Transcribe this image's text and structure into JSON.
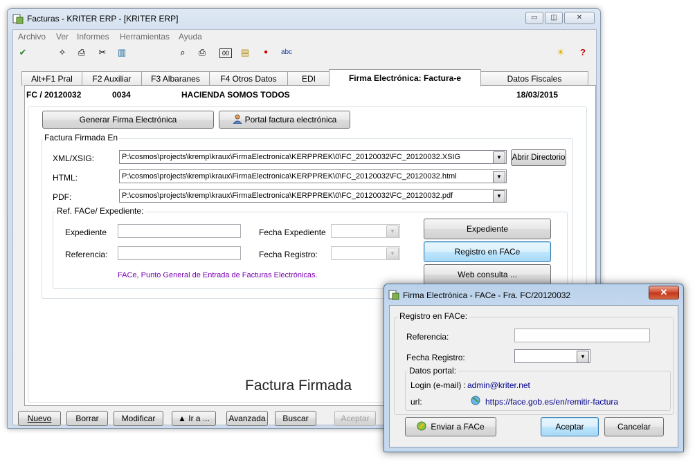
{
  "main": {
    "title": "Facturas - KRITER ERP - [KRITER ERP]",
    "caption_buttons": {
      "minimize": "▭",
      "restore": "◫",
      "close": "✕"
    },
    "menu": [
      "Archivo",
      "Ver",
      "Informes",
      "Herramientas",
      "Ayuda"
    ],
    "toolbar_icons": {
      "check": "✔",
      "run": "✧",
      "print": "⎙",
      "cut": "✂",
      "chart": "▥",
      "preview": "⌕",
      "printer": "⎙",
      "counter": "00",
      "folder": "▤",
      "bell": "●",
      "abc": "abc",
      "bulb": "☀",
      "help": "?"
    },
    "tabs": [
      "Alt+F1 Pral",
      "F2 Auxiliar",
      "F3 Albaranes",
      "F4 Otros Datos",
      "EDI",
      "Firma Electrónica: Factura-e",
      "Datos Fiscales"
    ],
    "header": {
      "code": "FC / 20120032",
      "num": "0034",
      "client": "HACIENDA SOMOS TODOS",
      "date": "18/03/2015"
    },
    "buttons": {
      "generar": "Generar Firma Electrónica",
      "portal": "Portal factura electrónica"
    },
    "factura_firmada": {
      "group_label": "Factura Firmada En",
      "xml_label": "XML/XSIG:",
      "xml_value": "P:\\cosmos\\projects\\kremp\\kraux\\FirmaElectronica\\KERPPREK\\0\\FC_20120032\\FC_20120032.XSIG",
      "html_label": "HTML:",
      "html_value": "P:\\cosmos\\projects\\kremp\\kraux\\FirmaElectronica\\KERPPREK\\0\\FC_20120032\\FC_20120032.html",
      "pdf_label": "PDF:",
      "pdf_value": "P:\\cosmos\\projects\\kremp\\kraux\\FirmaElectronica\\KERPPREK\\0\\FC_20120032\\FC_20120032.pdf",
      "abrir": "Abrir Directorio"
    },
    "ref_face": {
      "group_label": "Ref. FACe/ Expediente:",
      "expediente_label": "Expediente",
      "referencia_label": "Referencia:",
      "fecha_exp_label": "Fecha Expediente",
      "fecha_reg_label": "Fecha Registro:",
      "link_text": "FACe, Punto General de Entrada de Facturas Electrónicas.",
      "btn_expediente": "Expediente",
      "btn_registro": "Registro en FACe",
      "btn_web": "Web consulta ..."
    },
    "status_big": "Factura Firmada",
    "bottom_buttons": [
      "Nuevo",
      "Borrar",
      "Modificar",
      "▲ Ir a ...",
      "Avanzada",
      "Buscar",
      "Aceptar"
    ]
  },
  "dialog": {
    "title": "Firma Electrónica - FACe - Fra. FC/20120032",
    "close": "✕",
    "group_label": "Registro en FACe:",
    "referencia_label": "Referencia:",
    "fecha_label": "Fecha Registro:",
    "portal_label": "Datos portal:",
    "login_label": "Login (e-mail) :",
    "login_value": "admin@kriter.net",
    "url_label": "url:",
    "url_value": "https://face.gob.es/en/remitir-factura",
    "enviar": "Enviar a FACe",
    "aceptar": "Aceptar",
    "cancelar": "Cancelar"
  },
  "colors": {
    "accent": "#3c7fb1",
    "link_purple": "#7b00b4",
    "link_blue": "#00008b"
  }
}
